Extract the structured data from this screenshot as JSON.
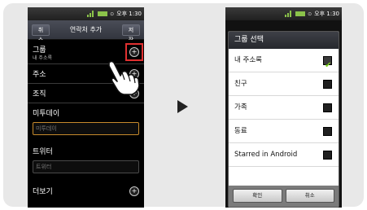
{
  "status": {
    "time": "오후 1:30",
    "signal_color": "#8bc34a"
  },
  "left": {
    "title": "연락처 추가",
    "cancel_label": "취소",
    "save_label": "저장",
    "group": {
      "label": "그룹",
      "value": "내 주소록"
    },
    "sections": [
      "주소",
      "조직"
    ],
    "birthday": {
      "label": "미투데이",
      "placeholder": "미투데이"
    },
    "twitter": {
      "label": "트위터",
      "placeholder": "트위터"
    },
    "more_label": "더보기",
    "highlight_color": "#e03030"
  },
  "right": {
    "dialog_title": "그룹 선택",
    "options": [
      {
        "label": "내 주소록",
        "checked": true
      },
      {
        "label": "친구",
        "checked": false
      },
      {
        "label": "가족",
        "checked": false
      },
      {
        "label": "동료",
        "checked": false
      },
      {
        "label": "Starred in Android",
        "checked": false
      }
    ],
    "confirm_label": "확인",
    "cancel_label": "취소"
  }
}
